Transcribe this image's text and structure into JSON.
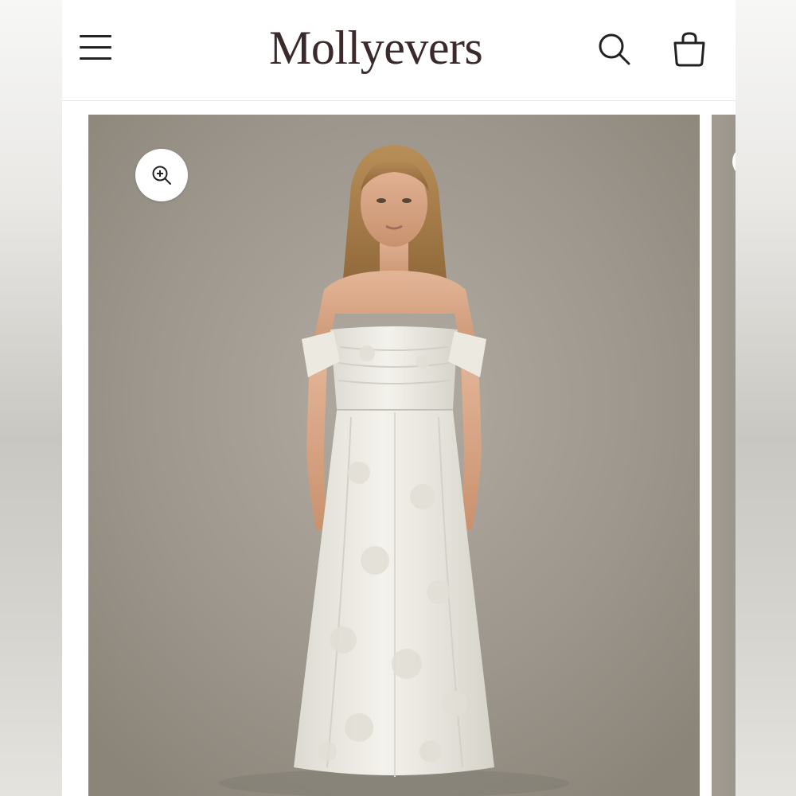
{
  "header": {
    "brand_name": "Mollyevers",
    "menu_icon": "hamburger-menu-icon",
    "search_icon": "search-icon",
    "cart_icon": "shopping-bag-icon"
  },
  "gallery": {
    "zoom_icon": "zoom-in-icon",
    "product_image": "model-in-white-off-shoulder-floral-midi-dress",
    "colors": {
      "backdrop": "#9e988e",
      "dress": "#f1efe8",
      "brand": "#3b2a2c"
    }
  }
}
